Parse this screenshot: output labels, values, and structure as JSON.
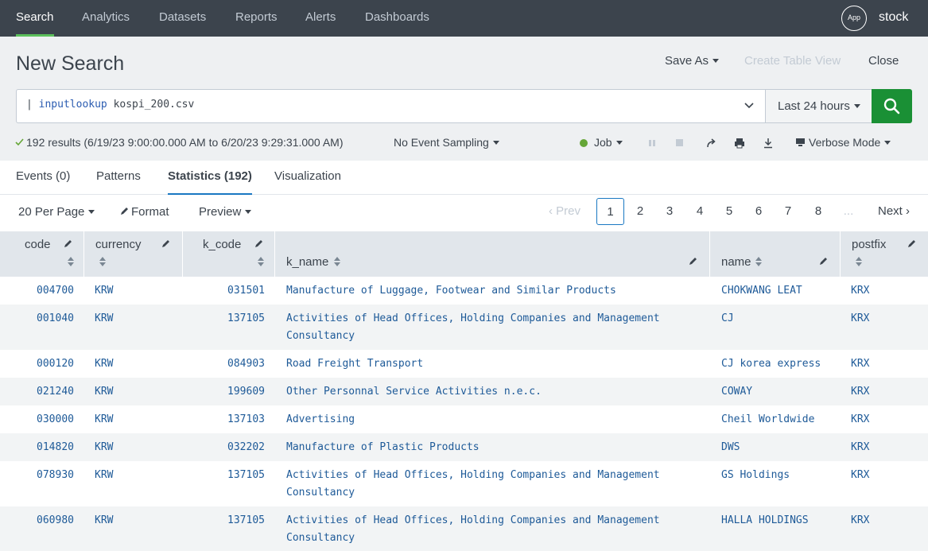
{
  "nav": {
    "items": [
      "Search",
      "Analytics",
      "Datasets",
      "Reports",
      "Alerts",
      "Dashboards"
    ],
    "app_badge": "App",
    "app_name": "stock"
  },
  "header": {
    "title": "New Search",
    "save_as": "Save As",
    "create_table_view": "Create Table View",
    "close": "Close"
  },
  "search": {
    "pipe": "|",
    "command": "inputlookup",
    "argument": "kospi_200.csv",
    "time_range": "Last 24 hours"
  },
  "status": {
    "results": "192 results (6/19/23 9:00:00.000 AM to 6/20/23 9:29:31.000 AM)",
    "sampling": "No Event Sampling",
    "job": "Job",
    "mode": "Verbose Mode"
  },
  "tabs": [
    "Events (0)",
    "Patterns",
    "Statistics (192)",
    "Visualization"
  ],
  "toolbar": {
    "per_page": "20 Per Page",
    "format": "Format",
    "preview": "Preview"
  },
  "pagination": {
    "prev": "Prev",
    "pages": [
      "1",
      "2",
      "3",
      "4",
      "5",
      "6",
      "7",
      "8"
    ],
    "ellipsis": "...",
    "next": "Next"
  },
  "table": {
    "columns": [
      "code",
      "currency",
      "k_code",
      "k_name",
      "name",
      "postfix"
    ],
    "rows": [
      {
        "code": "004700",
        "currency": "KRW",
        "k_code": "031501",
        "k_name": [
          "Manufacture of Luggage, Footwear and Similar Products"
        ],
        "name": "CHOKWANG LEAT",
        "postfix": "KRX"
      },
      {
        "code": "001040",
        "currency": "KRW",
        "k_code": "137105",
        "k_name": [
          "Activities of Head Offices, Holding Companies and Management",
          "Consultancy"
        ],
        "name": "CJ",
        "postfix": "KRX"
      },
      {
        "code": "000120",
        "currency": "KRW",
        "k_code": "084903",
        "k_name": [
          "Road Freight Transport"
        ],
        "name": "CJ korea express",
        "postfix": "KRX"
      },
      {
        "code": "021240",
        "currency": "KRW",
        "k_code": "199609",
        "k_name": [
          "Other Personnal Service Activities n.e.c."
        ],
        "name": "COWAY",
        "postfix": "KRX"
      },
      {
        "code": "030000",
        "currency": "KRW",
        "k_code": "137103",
        "k_name": [
          "Advertising"
        ],
        "name": "Cheil Worldwide",
        "postfix": "KRX"
      },
      {
        "code": "014820",
        "currency": "KRW",
        "k_code": "032202",
        "k_name": [
          "Manufacture of Plastic Products"
        ],
        "name": "DWS",
        "postfix": "KRX"
      },
      {
        "code": "078930",
        "currency": "KRW",
        "k_code": "137105",
        "k_name": [
          "Activities of Head Offices, Holding Companies and Management",
          "Consultancy"
        ],
        "name": "GS Holdings",
        "postfix": "KRX"
      },
      {
        "code": "060980",
        "currency": "KRW",
        "k_code": "137105",
        "k_name": [
          "Activities of Head Offices, Holding Companies and Management",
          "Consultancy"
        ],
        "name": "HALLA HOLDINGS",
        "postfix": "KRX"
      }
    ]
  },
  "colors": {
    "nav_bg": "#3c444d",
    "accent_green": "#5cc05c",
    "search_button": "#1a9035",
    "tab_accent": "#1a78c2",
    "cell_text": "#1e5a98",
    "job_dot": "#65a637"
  }
}
